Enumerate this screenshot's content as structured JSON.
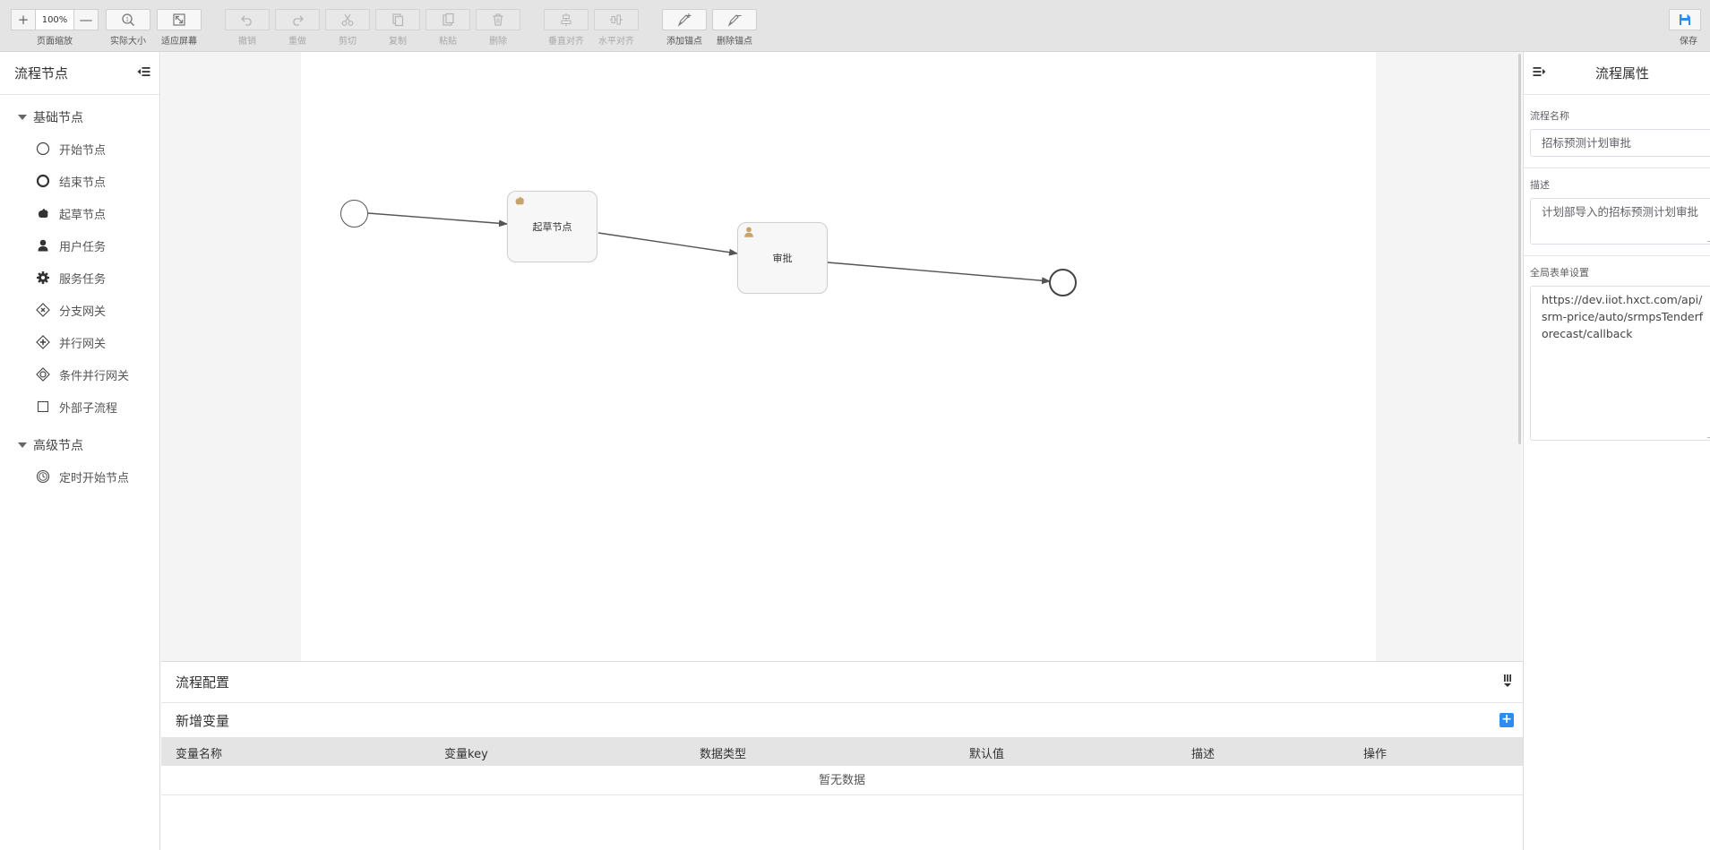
{
  "toolbar": {
    "zoom": {
      "minus": "+",
      "value": "100%",
      "plus": "—",
      "label": "页面缩放"
    },
    "actual_size": "实际大小",
    "fit_screen": "适应屏幕",
    "undo": "撤销",
    "redo": "重做",
    "cut": "剪切",
    "copy": "复制",
    "paste": "粘贴",
    "delete": "删除",
    "align_vertical": "垂直对齐",
    "align_horizontal": "水平对齐",
    "add_anchor": "添加锚点",
    "remove_anchor": "删除锚点",
    "save": "保存"
  },
  "left_panel": {
    "title": "流程节点",
    "groups": [
      {
        "title": "基础节点",
        "items": [
          {
            "label": "开始节点",
            "icon": "circle-thin-icon"
          },
          {
            "label": "结束节点",
            "icon": "circle-thick-icon"
          },
          {
            "label": "起草节点",
            "icon": "hand-icon"
          },
          {
            "label": "用户任务",
            "icon": "user-icon"
          },
          {
            "label": "服务任务",
            "icon": "gear-icon"
          },
          {
            "label": "分支网关",
            "icon": "exclusive-gateway-icon"
          },
          {
            "label": "并行网关",
            "icon": "parallel-gateway-icon"
          },
          {
            "label": "条件并行网关",
            "icon": "inclusive-gateway-icon"
          },
          {
            "label": "外部子流程",
            "icon": "square-icon"
          }
        ]
      },
      {
        "title": "高级节点",
        "items": [
          {
            "label": "定时开始节点",
            "icon": "timer-icon"
          }
        ]
      }
    ]
  },
  "canvas": {
    "nodes": {
      "draft": {
        "label": "起草节点"
      },
      "approve": {
        "label": "审批"
      }
    },
    "colors": {
      "icon": "#c9a36b",
      "stroke": "#555555",
      "node_bg": "#f7f7f7"
    }
  },
  "right_panel": {
    "title": "流程属性",
    "name_label": "流程名称",
    "name_value": "招标预测计划审批",
    "desc_label": "描述",
    "desc_value": "计划部导入的招标预测计划审批",
    "form_label": "全局表单设置",
    "form_value": "https://dev.iiot.hxct.com/api/srm-price/auto/srmpsTenderforecast/callback"
  },
  "bottom_panel": {
    "title": "流程配置",
    "subtitle": "新增变量",
    "add_symbol": "+",
    "columns": [
      "变量名称",
      "变量key",
      "数据类型",
      "默认值",
      "描述",
      "操作"
    ],
    "empty_text": "暂无数据",
    "accent": "#2d8cf0"
  }
}
